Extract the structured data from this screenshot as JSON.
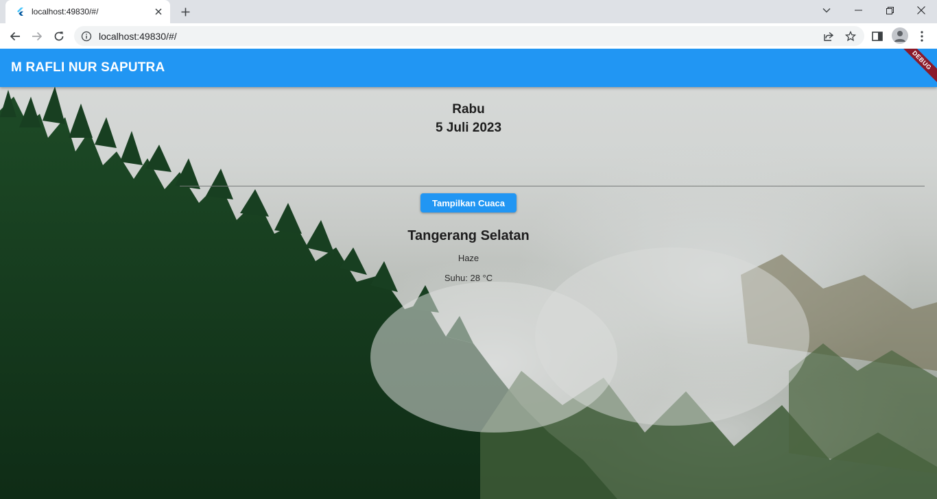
{
  "browser": {
    "tab_title": "localhost:49830/#/",
    "url": "localhost:49830/#/"
  },
  "app": {
    "title": "M RAFLI NUR SAPUTRA",
    "debug_label": "DEBUG",
    "day": "Rabu",
    "date": "5 Juli 2023",
    "button_label": "Tampilkan Cuaca",
    "weather": {
      "city": "Tangerang Selatan",
      "condition": "Haze",
      "temperature": "Suhu: 28 °C"
    }
  },
  "colors": {
    "appbar": "#2196f3",
    "button": "#2196f3",
    "debug_banner": "#8b1a2a"
  },
  "icons": [
    "flutter-icon",
    "close-icon",
    "plus-icon",
    "chevron-down-icon",
    "minimize-icon",
    "restore-icon",
    "back-icon",
    "forward-icon",
    "reload-icon",
    "info-icon",
    "share-icon",
    "star-icon",
    "side-panel-icon",
    "profile-icon",
    "menu-dots-icon"
  ]
}
